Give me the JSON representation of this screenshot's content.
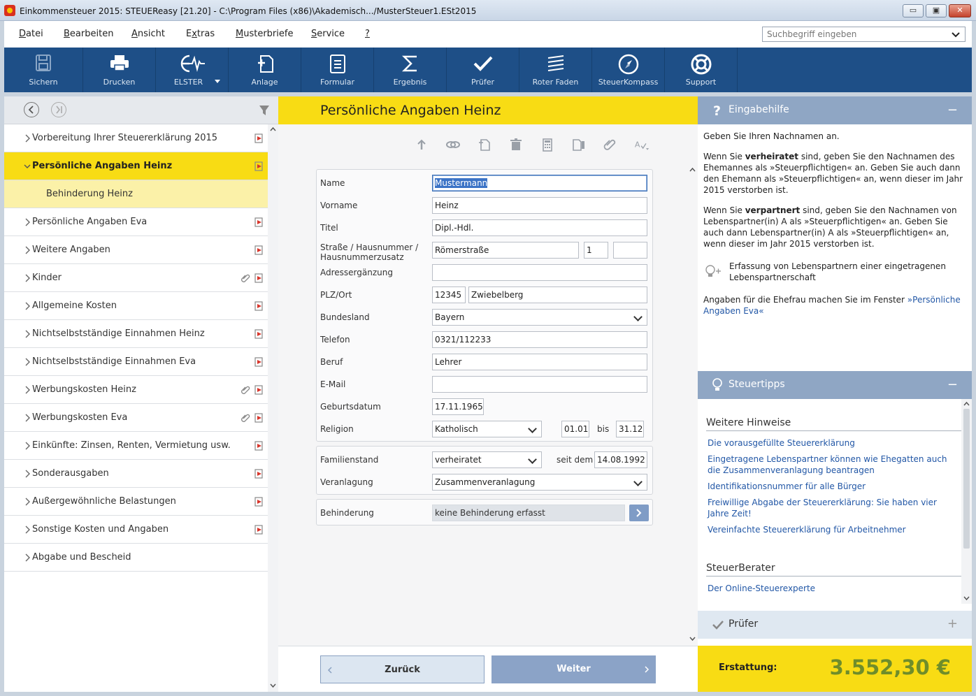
{
  "window": {
    "title": "Einkommensteuer 2015: STEUEReasy [21.20] - C:\\Program Files (x86)\\Akademisch.../MusterSteuer1.ESt2015",
    "btn_min": "▭",
    "btn_max": "▣",
    "btn_close": "✕"
  },
  "menu": {
    "items": [
      {
        "u": "D",
        "rest": "atei"
      },
      {
        "u": "B",
        "rest": "earbeiten"
      },
      {
        "u": "A",
        "rest": "nsicht"
      },
      {
        "pre": "E",
        "u": "x",
        "rest": "tras"
      },
      {
        "u": "M",
        "rest": "usterbriefe"
      },
      {
        "u": "S",
        "rest": "ervice"
      },
      {
        "u": "?",
        "rest": ""
      }
    ],
    "search_placeholder": "Suchbegriff eingeben"
  },
  "toolbar": {
    "items": [
      {
        "label": "Sichern",
        "icon": "save-icon"
      },
      {
        "label": "Drucken",
        "icon": "printer-icon"
      },
      {
        "label": "ELSTER",
        "icon": "elster-icon"
      },
      {
        "label": "Anlage",
        "icon": "add-document-icon"
      },
      {
        "label": "Formular",
        "icon": "form-icon"
      },
      {
        "label": "Ergebnis",
        "icon": "sigma-icon"
      },
      {
        "label": "Prüfer",
        "icon": "checkmark-icon"
      },
      {
        "label": "Roter Faden",
        "icon": "thread-icon"
      },
      {
        "label": "SteuerKompass",
        "icon": "compass-icon"
      },
      {
        "label": "Support",
        "icon": "lifebuoy-icon"
      }
    ]
  },
  "nav": {
    "items": [
      {
        "label": "Vorbereitung Ihrer Steuererklärung 2015"
      },
      {
        "label": "Persönliche Angaben Heinz"
      },
      {
        "label": "Behinderung Heinz"
      },
      {
        "label": "Persönliche Angaben Eva"
      },
      {
        "label": "Weitere Angaben"
      },
      {
        "label": "Kinder"
      },
      {
        "label": "Allgemeine Kosten"
      },
      {
        "label": "Nichtselbstständige Einnahmen Heinz"
      },
      {
        "label": "Nichtselbstständige Einnahmen Eva"
      },
      {
        "label": "Werbungskosten Heinz"
      },
      {
        "label": "Werbungskosten Eva"
      },
      {
        "label": "Einkünfte: Zinsen, Renten, Vermietung usw."
      },
      {
        "label": "Sonderausgaben"
      },
      {
        "label": "Außergewöhnliche Belastungen"
      },
      {
        "label": "Sonstige Kosten und Angaben"
      },
      {
        "label": "Abgabe und Bescheid"
      }
    ]
  },
  "form": {
    "title": "Persönliche Angaben Heinz",
    "labels": {
      "name": "Name",
      "vorname": "Vorname",
      "titel": "Titel",
      "strasse1": "Straße / Hausnummer /",
      "strasse2": "Hausnummerzusatz",
      "adresse": "Adressergänzung",
      "plz": "PLZ/Ort",
      "bundesland": "Bundesland",
      "telefon": "Telefon",
      "beruf": "Beruf",
      "email": "E-Mail",
      "geburtsdatum": "Geburtsdatum",
      "religion": "Religion",
      "bis": "bis",
      "familienstand": "Familienstand",
      "seit_dem": "seit dem",
      "veranlagung": "Veranlagung",
      "behinderung": "Behinderung"
    },
    "values": {
      "name": "Mustermann",
      "vorname": "Heinz",
      "titel": "Dipl.-Hdl.",
      "strasse": "Römerstraße",
      "hausnummer": "1",
      "zusatz": "",
      "adresse": "",
      "plz": "12345",
      "ort": "Zwiebelberg",
      "bundesland": "Bayern",
      "telefon": "0321/112233",
      "beruf": "Lehrer",
      "email": "",
      "geburtsdatum": "17.11.1965",
      "religion": "Katholisch",
      "religion_von": "01.01",
      "religion_bis": "31.12",
      "familienstand": "verheiratet",
      "seit_dem": "14.08.1992",
      "veranlagung": "Zusammenveranlagung",
      "behinderung": "keine Behinderung erfasst"
    },
    "back_label": "Zurück",
    "next_label": "Weiter"
  },
  "help": {
    "title": "Eingabehilfe",
    "p1": "Geben Sie Ihren Nachnamen an.",
    "p2_pre": "Wenn Sie ",
    "p2_bold": "verheiratet",
    "p2_post": " sind, geben Sie den Nachnamen des Ehemannes als »Steuerpflichtigen« an. Geben Sie auch dann den Ehemann als »Steuerpflichtigen« an, wenn dieser im Jahr 2015 verstorben ist.",
    "p3_pre": "Wenn Sie ",
    "p3_bold": "verpartnert",
    "p3_post": " sind, geben Sie den Nachnamen von Lebenspartner(in) A als »Steuerpflichtigen« an. Geben Sie auch dann Lebenspartner(in) A als »Steuerpflichtigen« an, wenn dieser im Jahr 2015 verstorben ist.",
    "link1": "Erfassung von Lebenspartnern einer eingetragenen Lebenspartnerschaft",
    "p4_pre": "Angaben für die Ehefrau machen Sie im Fenster ",
    "p4_link": "»Persönliche Angaben Eva«"
  },
  "tips": {
    "title": "Steuertipps",
    "section1": "Weitere Hinweise",
    "links": [
      "Die vorausgefüllte Steuererklärung",
      "Eingetragene Lebenspartner können wie Ehegatten auch die Zusammenveranlagung beantragen",
      "Identifikationsnummer für alle Bürger",
      "Freiwillige Abgabe der Steuererklärung: Sie haben vier Jahre Zeit!",
      "Vereinfachte Steuererklärung für Arbeitnehmer"
    ],
    "section2": "SteuerBerater",
    "link_berater": "Der Online-Steuerexperte"
  },
  "pruefer": {
    "title": "Prüfer"
  },
  "result": {
    "label": "Erstattung:",
    "amount": "3.552,30 €"
  }
}
